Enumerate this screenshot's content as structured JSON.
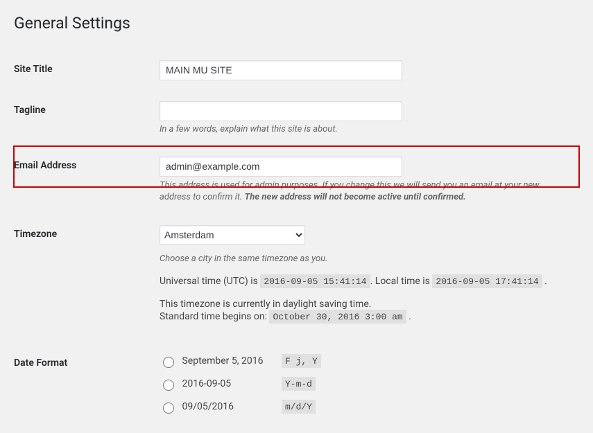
{
  "page": {
    "title": "General Settings"
  },
  "site_title": {
    "label": "Site Title",
    "value": "MAIN MU SITE"
  },
  "tagline": {
    "label": "Tagline",
    "value": "",
    "description": "In a few words, explain what this site is about."
  },
  "email": {
    "label": "Email Address",
    "value": "admin@example.com",
    "description_1": "This address is used for admin purposes. If you change this we will send you an email at your new address to confirm it. ",
    "description_2": "The new address will not become active until confirmed."
  },
  "timezone": {
    "label": "Timezone",
    "value": "Amsterdam",
    "description": "Choose a city in the same timezone as you.",
    "utc_prefix": "Universal time (UTC) is ",
    "utc_value": "2016-09-05 15:41:14",
    "local_prefix": ". Local time is ",
    "local_value": "2016-09-05 17:41:14",
    "local_suffix": " .",
    "dst_line": "This timezone is currently in daylight saving time.",
    "std_prefix": "Standard time begins on: ",
    "std_value": "October 30, 2016 3:00 am",
    "std_suffix": " ."
  },
  "date_format": {
    "label": "Date Format",
    "options": [
      {
        "example": "September 5, 2016",
        "code": "F j, Y"
      },
      {
        "example": "2016-09-05",
        "code": "Y-m-d"
      },
      {
        "example": "09/05/2016",
        "code": "m/d/Y"
      }
    ]
  }
}
